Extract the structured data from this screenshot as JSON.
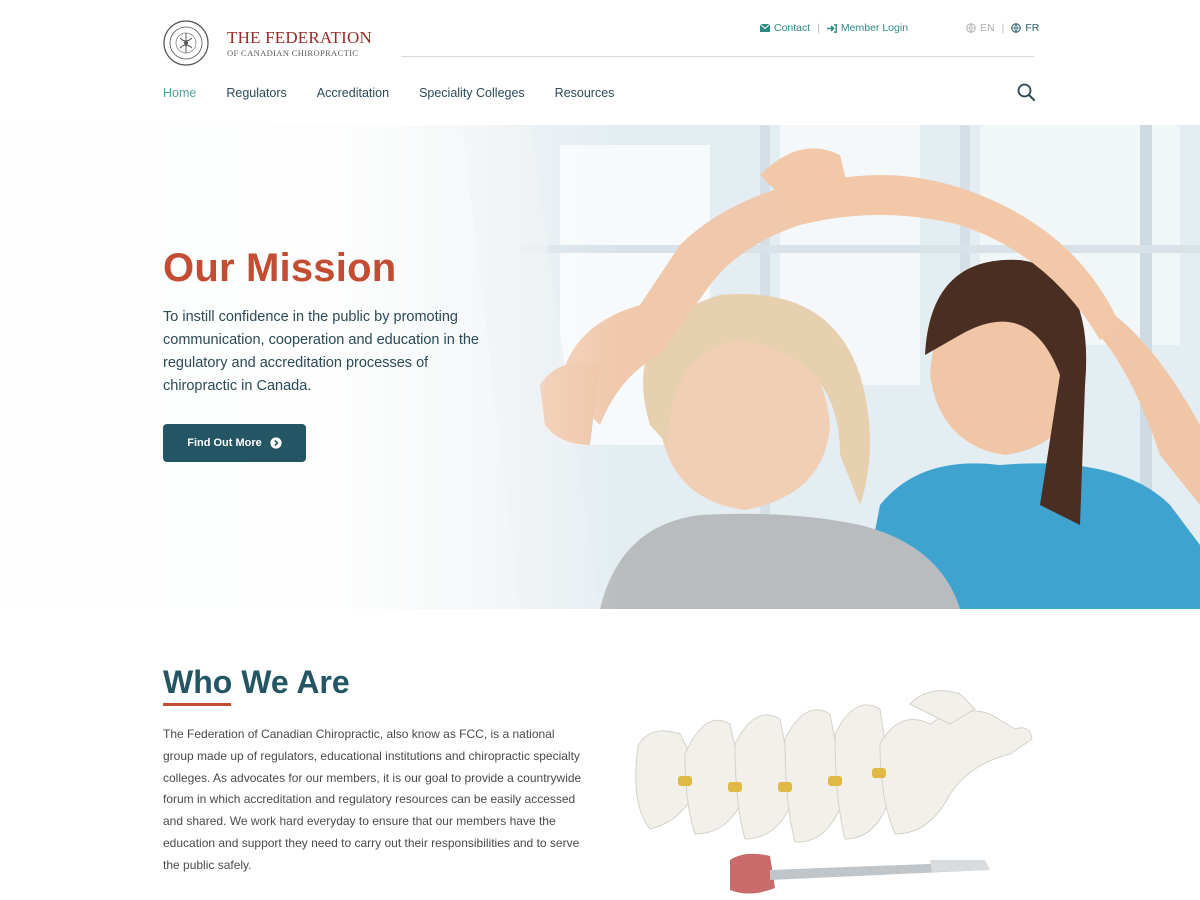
{
  "brand": {
    "title": "THE FEDERATION",
    "subtitle": "OF CANADIAN CHIROPRACTIC",
    "seal_icon": "federation-seal-icon"
  },
  "utility": {
    "contact": "Contact",
    "member_login": "Member Login",
    "lang_en": "EN",
    "lang_fr": "FR"
  },
  "nav": {
    "items": [
      "Home",
      "Regulators",
      "Accreditation",
      "Speciality Colleges",
      "Resources"
    ],
    "active": "Home"
  },
  "hero": {
    "title": "Our Mission",
    "text": "To instill confidence in the public by promoting communication, cooperation and education in the regulatory and accreditation processes of chiropractic in Canada.",
    "button": "Find Out More"
  },
  "who": {
    "title": "Who We Are",
    "text": "The Federation of Canadian Chiropractic, also know as FCC, is a national group made up of regulators, educational institutions and chiropractic specialty colleges. As advocates for our members, it is our goal to provide a countrywide forum in which accreditation and regulatory resources can be easily accessed and shared. We work hard everyday to ensure that our members have the education and support they need to carry out their responsibilities and to serve the public safely."
  },
  "colors": {
    "accent_red": "#c34d33",
    "brand_teal": "#245565",
    "link_teal": "#2e8a83",
    "logo_red": "#9a2b24"
  }
}
